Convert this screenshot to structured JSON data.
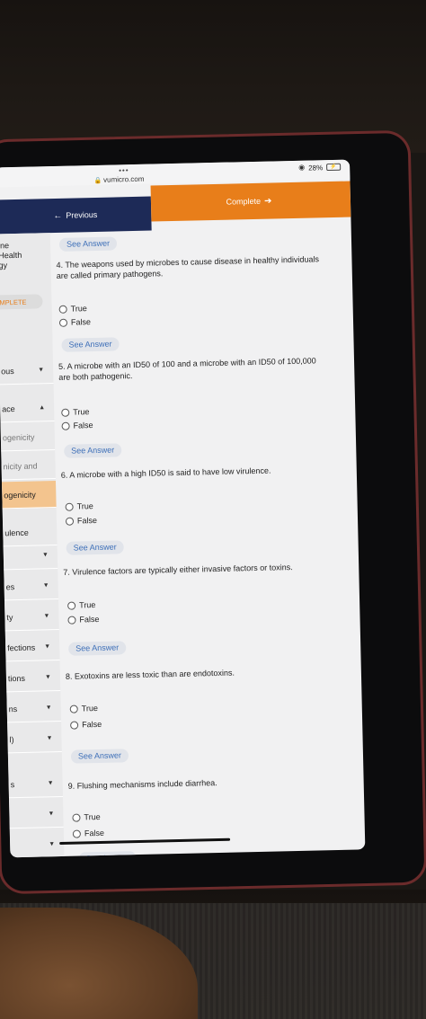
{
  "browser": {
    "url": "vumicro.com",
    "battery": "28%",
    "dots": "•••"
  },
  "nav": {
    "previous_label": "Previous",
    "complete_label": "Complete"
  },
  "sidebar": {
    "header": "ine\nHealth\ngy",
    "pill": "MPLETE",
    "items": [
      {
        "label": "ous"
      },
      {
        "label": "ace"
      },
      {
        "label": "ogenicity"
      },
      {
        "label": "nicity and"
      },
      {
        "label": "ogenicity"
      },
      {
        "label": "ulence"
      },
      {
        "label": ""
      },
      {
        "label": "es"
      },
      {
        "label": "ty"
      },
      {
        "label": "fections"
      },
      {
        "label": "tions"
      },
      {
        "label": "ns"
      },
      {
        "label": "l)"
      },
      {
        "label": "s"
      },
      {
        "label": ""
      },
      {
        "label": ""
      }
    ]
  },
  "see_answer_label": "See Answer",
  "questions": [
    {
      "text": "4. The weapons used by microbes to cause disease in healthy individuals are called primary pathogens.",
      "options": [
        "True",
        "False"
      ]
    },
    {
      "text": "5. A microbe with an ID50 of 100 and a microbe with an ID50 of 100,000 are both pathogenic.",
      "options": [
        "True",
        "False"
      ]
    },
    {
      "text": "6. A microbe with a high ID50 is said to have low virulence.",
      "options": [
        "True",
        "False"
      ]
    },
    {
      "text": "7. Virulence factors are typically either invasive factors or toxins.",
      "options": [
        "True",
        "False"
      ]
    },
    {
      "text": "8. Exotoxins are less toxic than are endotoxins.",
      "options": [
        "True",
        "False"
      ]
    },
    {
      "text": "9. Flushing mechanisms include diarrhea.",
      "options": [
        "True",
        "False"
      ]
    }
  ]
}
